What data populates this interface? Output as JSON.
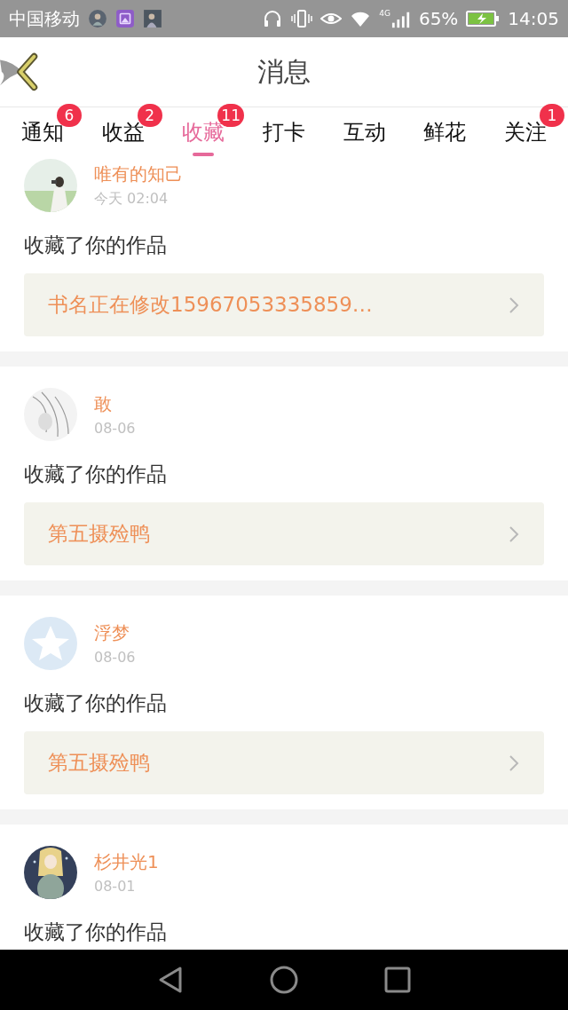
{
  "status_bar": {
    "carrier": "中国移动",
    "network": "4G",
    "battery": "65%",
    "time": "14:05"
  },
  "header": {
    "title": "消息"
  },
  "tabs": [
    {
      "label": "通知",
      "badge": "6",
      "selected": false
    },
    {
      "label": "收益",
      "badge": "2",
      "selected": false
    },
    {
      "label": "收藏",
      "badge": "11",
      "selected": true
    },
    {
      "label": "打卡",
      "selected": false
    },
    {
      "label": "互动",
      "selected": false
    },
    {
      "label": "鲜花",
      "selected": false
    },
    {
      "label": "关注",
      "badge": "1",
      "selected": false
    }
  ],
  "messages": [
    {
      "user": "唯有的知己",
      "time": "今天 02:04",
      "text": "收藏了你的作品",
      "book": "书名正在修改15967053335859…"
    },
    {
      "user": "敢",
      "time": "08-06",
      "text": "收藏了你的作品",
      "book": "第五摄殓鸭"
    },
    {
      "user": "浮梦",
      "time": "08-06",
      "text": "收藏了你的作品",
      "book": "第五摄殓鸭"
    },
    {
      "user": "杉井光1",
      "time": "08-01",
      "text": "收藏了你的作品"
    }
  ]
}
